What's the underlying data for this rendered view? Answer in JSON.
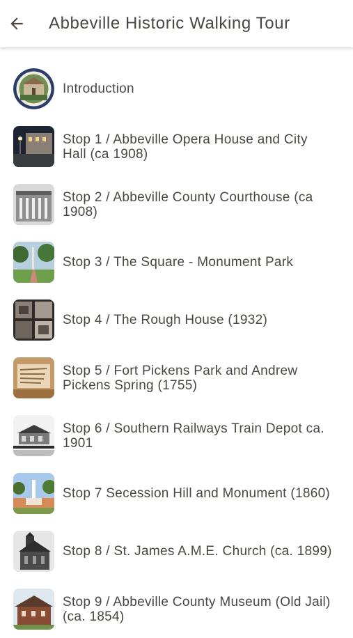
{
  "header": {
    "back_icon": "arrow-left-icon",
    "title": "Abbeville Historic Walking Tour"
  },
  "colors": {
    "text": "#4b4642",
    "background": "#ffffff"
  },
  "stops": [
    {
      "label": "Introduction",
      "thumbnail": "round seal badge"
    },
    {
      "label": "Stop 1 / Abbeville Opera House and City Hall (ca 1908)",
      "thumbnail": "night street photo"
    },
    {
      "label": "Stop 2 / Abbeville County Courthouse (ca 1908)",
      "thumbnail": "black-and-white courthouse photo"
    },
    {
      "label": "Stop 3 / The Square - Monument Park",
      "thumbnail": "park with monument photo"
    },
    {
      "label": "Stop 4 / The Rough House (1932)",
      "thumbnail": "old photo collage"
    },
    {
      "label": "Stop 5 / Fort Pickens Park and Andrew Pickens Spring (1755)",
      "thumbnail": "sepia old document photo"
    },
    {
      "label": "Stop 6 / Southern Railways Train Depot ca. 1901",
      "thumbnail": "black-and-white train depot photo"
    },
    {
      "label": "Stop 7 Secession Hill and Monument (1860)",
      "thumbnail": "monument on hill photo"
    },
    {
      "label": "Stop 8 / St. James A.M.E. Church (ca. 1899)",
      "thumbnail": "black-and-white church photo"
    },
    {
      "label": "Stop 9 / Abbeville County Museum (Old Jail) (ca. 1854)",
      "thumbnail": "brick jail building photo"
    }
  ]
}
